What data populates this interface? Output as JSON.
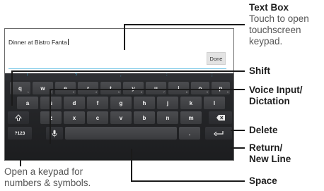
{
  "textbox": {
    "value": "Dinner at Bistro Fanta",
    "done_label": "Done"
  },
  "keyboard": {
    "hints": [
      "!",
      "?",
      ",",
      ":",
      ";"
    ],
    "row1": [
      "q",
      "w",
      "e",
      "r",
      "t",
      "y",
      "u",
      "i",
      "o",
      "p"
    ],
    "row1_subs": [
      "1",
      "2",
      "3",
      "4",
      "5",
      "6",
      "7",
      "8",
      "9",
      "0"
    ],
    "row2": [
      "a",
      "s",
      "d",
      "f",
      "g",
      "h",
      "j",
      "k",
      "l"
    ],
    "row3": [
      "z",
      "x",
      "c",
      "v",
      "b",
      "n",
      "m"
    ],
    "symbols_label": "?123",
    "period_label": ".",
    "icons": {
      "shift": "shift-icon",
      "mic": "microphone-icon",
      "delete": "backspace-icon",
      "return": "return-arrow-icon"
    }
  },
  "callouts": {
    "text_box_title": "Text Box",
    "text_box_desc_1": "Touch to open",
    "text_box_desc_2": "touchscreen",
    "text_box_desc_3": "keypad.",
    "shift": "Shift",
    "voice_1": "Voice Input/",
    "voice_2": "Dictation",
    "delete": "Delete",
    "return_1": "Return/",
    "return_2": "New Line",
    "space": "Space",
    "symbols_1": "Open a keypad for",
    "symbols_2": "numbers & symbols."
  },
  "colors": {
    "accent": "#3c9bc4",
    "keyboard_bg": "#1c1d1f",
    "key_bg": "#444549"
  }
}
